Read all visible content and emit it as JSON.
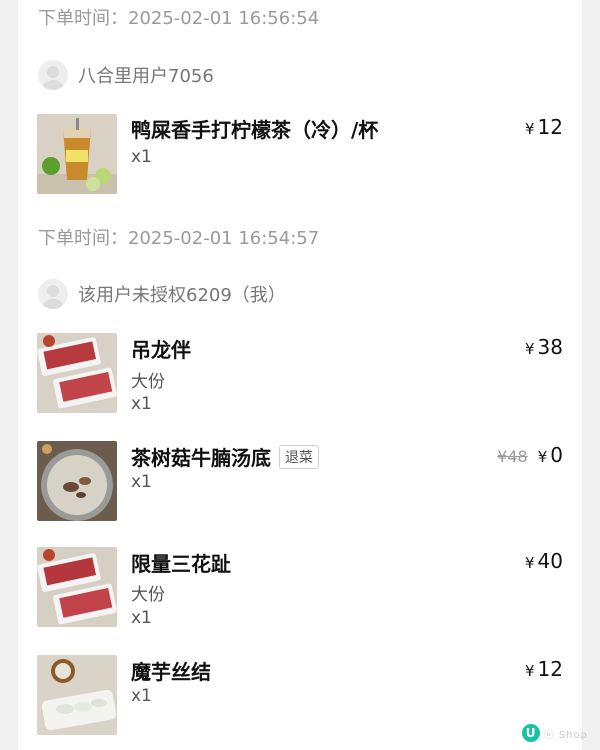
{
  "orders": [
    {
      "time_label": "下单时间：",
      "time_value": "2025-02-01 16:56:54",
      "user": "八合里用户7056",
      "items": [
        {
          "name": "鸭屎香手打柠檬茶（冷）/杯",
          "qty": "x1",
          "currency": "¥",
          "price": "12"
        }
      ]
    },
    {
      "time_label": "下单时间：",
      "time_value": "2025-02-01 16:54:57",
      "user": "该用户未授权6209（我）",
      "items": [
        {
          "name": "吊龙伴",
          "spec": "大份",
          "qty": "x1",
          "currency": "¥",
          "price": "38"
        },
        {
          "name": "茶树菇牛腩汤底",
          "tag": "退菜",
          "qty": "x1",
          "original_price": "¥48",
          "currency": "¥",
          "price": "0"
        },
        {
          "name": "限量三花趾",
          "spec": "大份",
          "qty": "x1",
          "currency": "¥",
          "price": "40"
        },
        {
          "name": "魔芋丝结",
          "qty": "x1",
          "currency": "¥",
          "price": "12"
        }
      ]
    }
  ],
  "watermark": {
    "logo_letter": "U",
    "text": "ⓤ Shop"
  }
}
